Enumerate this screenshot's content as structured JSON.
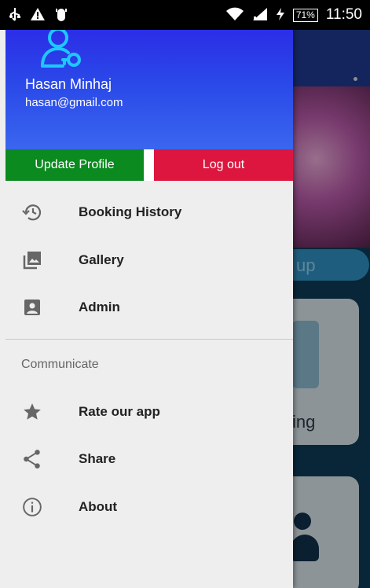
{
  "status_bar": {
    "left_icons": [
      "usb-icon",
      "warning-icon",
      "android-debug-icon"
    ],
    "right_icons": [
      "wifi-icon",
      "signal-icon",
      "charging-icon"
    ],
    "battery": "71%",
    "time": "11:50"
  },
  "background": {
    "pill_text": "up",
    "card_text": "ing"
  },
  "drawer": {
    "header": {
      "name": "Hasan Minhaj",
      "email": "hasan@gmail.com",
      "icon": "user-key-icon",
      "colors": {
        "top": "#2c1fe6",
        "bottom": "#3a66ef"
      }
    },
    "buttons": {
      "update": "Update Profile",
      "logout": "Log out",
      "update_color": "#0a8a1f",
      "logout_color": "#dc163e"
    },
    "items": [
      {
        "label": "Booking History",
        "icon": "history-icon"
      },
      {
        "label": "Gallery",
        "icon": "gallery-icon"
      },
      {
        "label": "Admin",
        "icon": "admin-icon"
      }
    ],
    "section_title": "Communicate",
    "communicate_items": [
      {
        "label": "Rate our app",
        "icon": "star-icon"
      },
      {
        "label": "Share",
        "icon": "share-icon"
      },
      {
        "label": "About",
        "icon": "info-icon"
      }
    ]
  }
}
